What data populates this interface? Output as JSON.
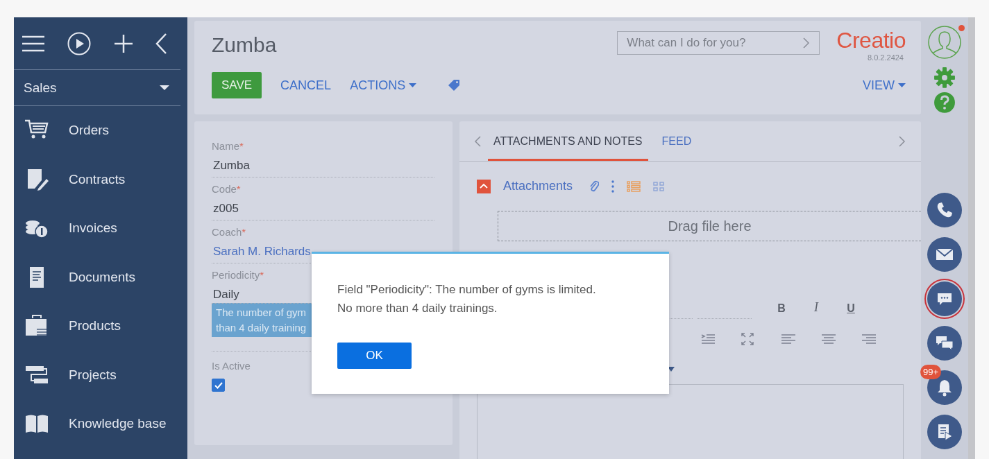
{
  "sidebar": {
    "section": "Sales",
    "items": [
      {
        "label": "Orders",
        "kind": "cart"
      },
      {
        "label": "Contracts",
        "kind": "contract"
      },
      {
        "label": "Invoices",
        "kind": "coins"
      },
      {
        "label": "Documents",
        "kind": "document"
      },
      {
        "label": "Products",
        "kind": "product"
      },
      {
        "label": "Projects",
        "kind": "project"
      },
      {
        "label": "Knowledge base",
        "kind": "book"
      }
    ]
  },
  "header": {
    "title": "Zumba",
    "search": {
      "placeholder": "What can I do for you?"
    },
    "logo": "Creatio",
    "version": "8.0.2.2424",
    "buttons": [
      {
        "label": "SAVE",
        "kind": "primary"
      },
      {
        "label": "CANCEL",
        "kind": "link"
      },
      {
        "label": "ACTIONS",
        "kind": "menu"
      }
    ],
    "view": "VIEW"
  },
  "form": {
    "fields": [
      {
        "label": "Name",
        "mark": "*",
        "value": "Zumba",
        "kind": "text"
      },
      {
        "label": "Code",
        "mark": "*",
        "value": "z005",
        "kind": "text"
      },
      {
        "label": "Coach",
        "mark": "*",
        "value": "Sarah M. Richards",
        "kind": "lookup"
      },
      {
        "label": "Periodicity",
        "mark": "*",
        "value": "Daily",
        "kind": "text"
      }
    ],
    "tooltip": [
      "The number of gym",
      "than 4 daily training"
    ],
    "is_active": {
      "label": "Is Active",
      "checked": true
    }
  },
  "tabs": [
    {
      "label": "ATTACHMENTS AND NOTES",
      "selected": true
    },
    {
      "label": "FEED",
      "selected": false
    }
  ],
  "attachments": {
    "title": "Attachments",
    "expanded": true,
    "drop_hint": "Drag file here"
  },
  "editor": {
    "buttons": [
      {
        "label": "B",
        "kind": "bold"
      },
      {
        "label": "I",
        "kind": "italic"
      },
      {
        "label": "U",
        "kind": "underline"
      }
    ]
  },
  "dialog": {
    "lines": [
      "Field \"Periodicity\": The number of gyms is limited.",
      "No more than 4 daily trainings."
    ],
    "button": "OK"
  },
  "rail": {
    "profile_alert": true,
    "buttons": [
      {
        "kind": "phone",
        "selected": false
      },
      {
        "kind": "mail",
        "selected": false
      },
      {
        "kind": "chat",
        "selected": true
      },
      {
        "kind": "messages",
        "selected": false
      },
      {
        "kind": "bell",
        "selected": false,
        "badge": "99+"
      },
      {
        "kind": "process",
        "selected": false
      }
    ]
  }
}
